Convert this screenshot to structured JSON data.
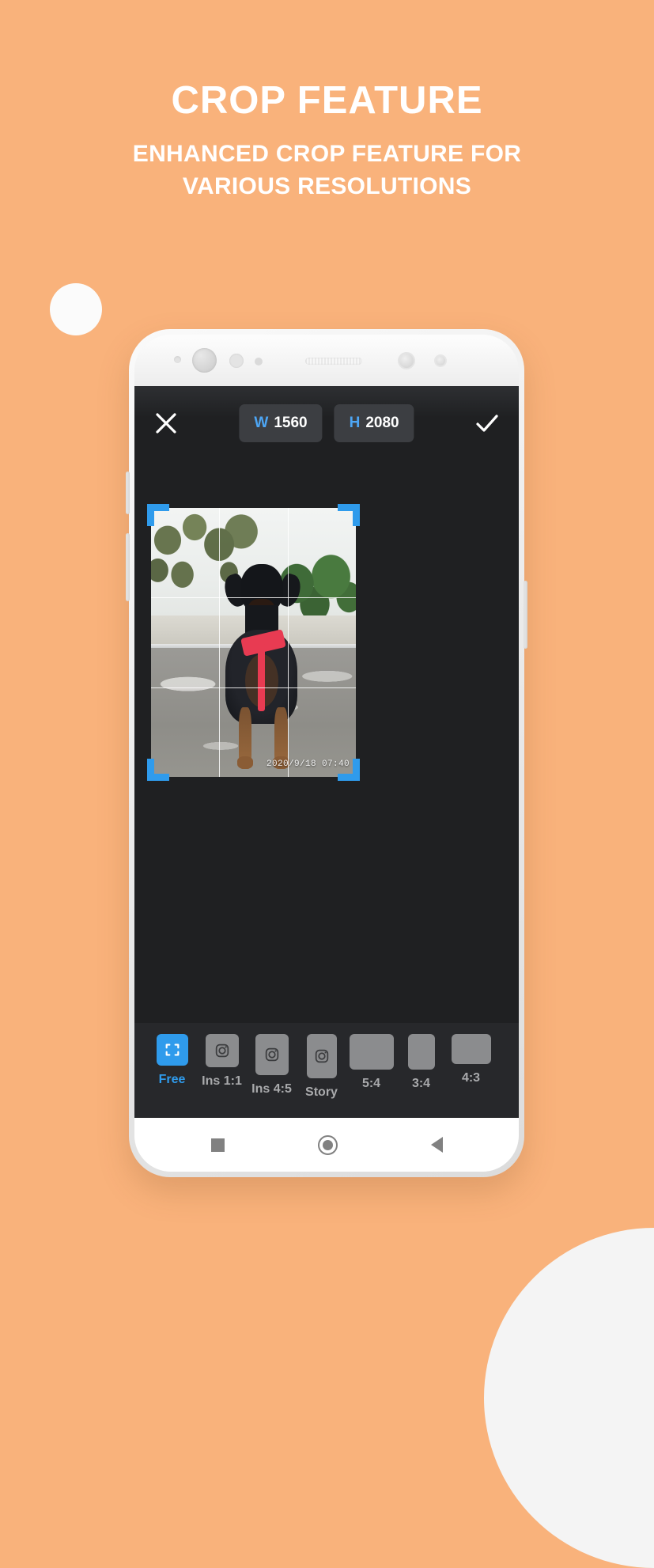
{
  "theme": {
    "background": "#F9B27B",
    "accent_blue": "#2F9BEC",
    "chip_blue": "#4DA6F5",
    "screen_dark": "#1F2022",
    "bar_dark": "#27282B",
    "harness_red": "#E83B52"
  },
  "promo": {
    "headline": "CROP FEATURE",
    "subhead_line1": "ENHANCED CROP FEATURE FOR",
    "subhead_line2": "VARIOUS RESOLUTIONS"
  },
  "app": {
    "toolbar": {
      "close_icon": "close-icon",
      "confirm_icon": "check-icon",
      "width_chip": {
        "key": "W",
        "value": "1560"
      },
      "height_chip": {
        "key": "H",
        "value": "2080"
      }
    },
    "photo": {
      "timestamp": "2020/9/18 07:40",
      "grid": "rule-of-thirds",
      "handles": [
        "top-left",
        "top-right",
        "bottom-left",
        "bottom-right"
      ]
    },
    "ratios": [
      {
        "label": "Free",
        "icon": "crop-free-icon",
        "selected": true
      },
      {
        "label": "Ins 1:1",
        "icon": "instagram-icon",
        "selected": false
      },
      {
        "label": "Ins 4:5",
        "icon": "instagram-icon",
        "selected": false
      },
      {
        "label": "Story",
        "icon": "instagram-icon",
        "selected": false
      },
      {
        "label": "5:4",
        "icon": "rectangle-icon",
        "selected": false
      },
      {
        "label": "3:4",
        "icon": "rectangle-icon",
        "selected": false
      },
      {
        "label": "4:3",
        "icon": "rectangle-icon",
        "selected": false
      }
    ]
  },
  "device": {
    "nav": {
      "recents": "square-icon",
      "home": "circle-icon",
      "back": "triangle-back-icon"
    },
    "hardware": [
      "sensor-dot",
      "front-camera",
      "proximity-sensor",
      "led-dot",
      "earpiece-speaker",
      "iris-camera",
      "iris-sensor"
    ]
  }
}
